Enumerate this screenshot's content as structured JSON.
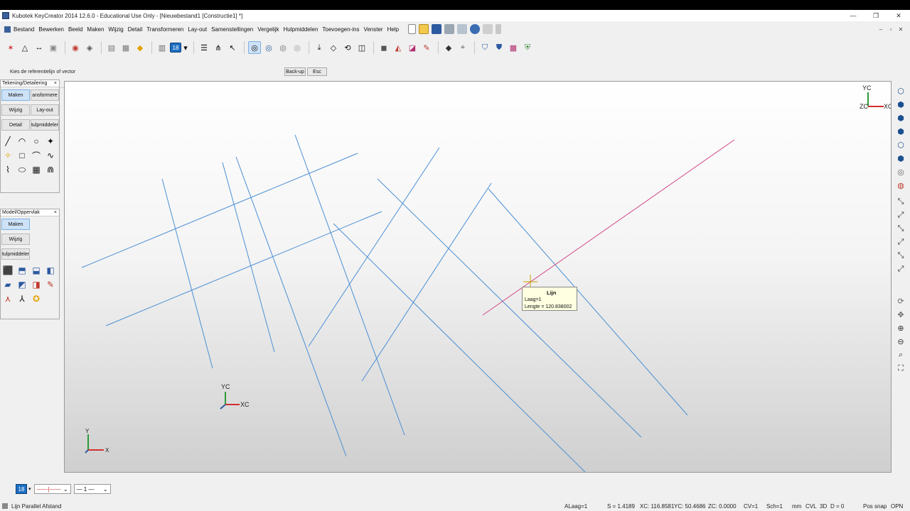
{
  "window": {
    "title": "Kubotek KeyCreator 2014 12.6.0 - Educational Use Only - [Nieuwbestand1 [Constructie1] *]",
    "minimize": "—",
    "restore": "❐",
    "close": "✕"
  },
  "menu": {
    "items": [
      "Bestand",
      "Bewerken",
      "Beeld",
      "Maken",
      "Wijzig",
      "Detail",
      "Transformeren",
      "Lay-out",
      "Samenstellingen",
      "Vergelijk",
      "Hulpmiddelen",
      "Toevoegen-ins",
      "Venster",
      "Help"
    ],
    "mdi_min": "‒",
    "mdi_restore": "▫",
    "mdi_close": "✕"
  },
  "toolbar": {
    "layer_value": "18"
  },
  "prompt": {
    "text": "Kies de referentielijn of vector",
    "backup": "Back-up",
    "esc": "Esc"
  },
  "palette_drawing": {
    "title": "Tekening/Detailering",
    "close": "×",
    "buttons": [
      "Maken",
      "ansformere",
      "Wijzig",
      "Lay-out",
      "Detail",
      "tulpmiddeler"
    ]
  },
  "palette_model": {
    "title": "Model/Oppervlak",
    "close": "×",
    "buttons": [
      "Maken",
      "Wijzig",
      "tulpmiddeler"
    ]
  },
  "viewport": {
    "axes": {
      "yc": "YC",
      "xc": "XC",
      "zc": "ZC",
      "y": "Y",
      "x": "X"
    },
    "line_color": "#4a8fd4",
    "highlight_color": "#d24a8a"
  },
  "tooltip": {
    "title": "Lijn",
    "layer": "Laag=1",
    "length": "Lengte = 120.838002"
  },
  "bottom": {
    "layer": "18",
    "linetype": "——|——",
    "linewidth": "— 1 —"
  },
  "status": {
    "command": "Lijn Parallel Afstand",
    "alaag": "ALaag=1",
    "scale": "S = 1.4189",
    "xc": "XC: 116.8581",
    "yc": "YC: 50.4686",
    "zc": "ZC: 0.0000",
    "cv": "CV=1",
    "sch": "Sch=1",
    "units": "mm",
    "cvl": "CVL",
    "mode": "3D",
    "depth": "D = 0",
    "possnap": "Pos snap",
    "opn": "OPN"
  }
}
